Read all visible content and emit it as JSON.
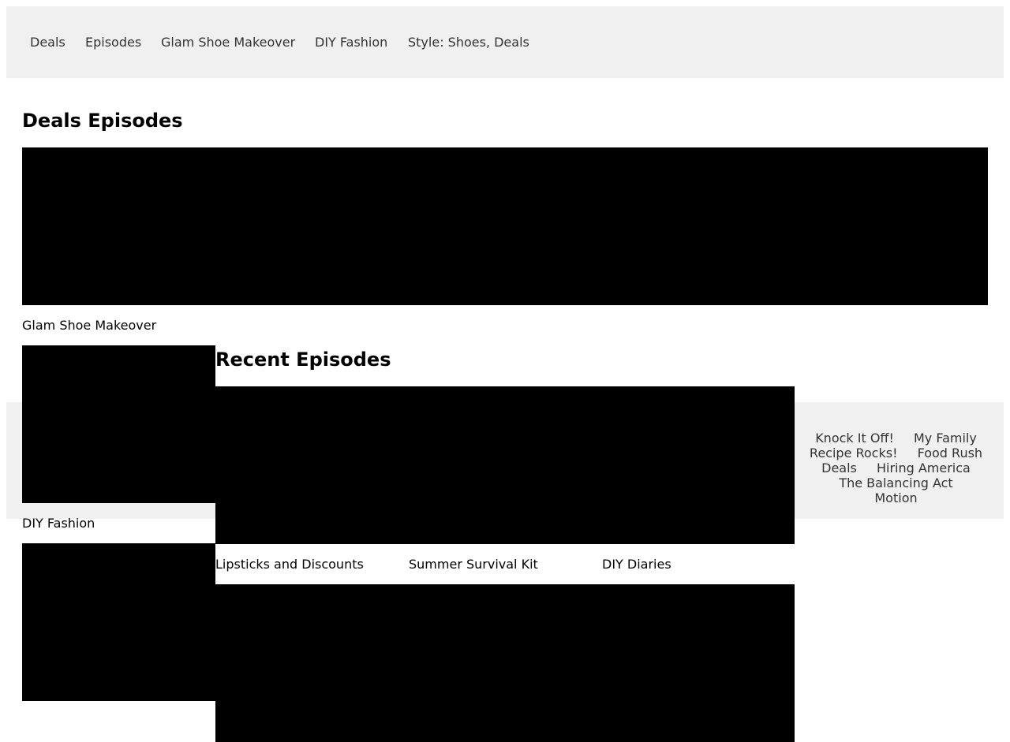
{
  "nav": {
    "items": [
      "Deals",
      "Episodes",
      "Glam Shoe Makeover",
      "DIY Fashion",
      "Style: Shoes, Deals"
    ]
  },
  "deals_section": {
    "title": "Deals Episodes",
    "items": [
      {
        "label": "Glam Shoe Makeover"
      },
      {
        "label": "DIY Fashion"
      }
    ]
  },
  "recent_section": {
    "title": "Recent Episodes",
    "items": [
      {
        "label": "Lipsticks and Discounts"
      },
      {
        "label": "Summer Survival Kit"
      },
      {
        "label": "DIY Diaries"
      }
    ]
  },
  "footer": {
    "links": [
      "Knock It Off!",
      "My Family",
      "Recipe Rocks!",
      "Food Rush",
      "Deals",
      "Hiring America",
      "The Balancing Act",
      "Motion"
    ]
  }
}
